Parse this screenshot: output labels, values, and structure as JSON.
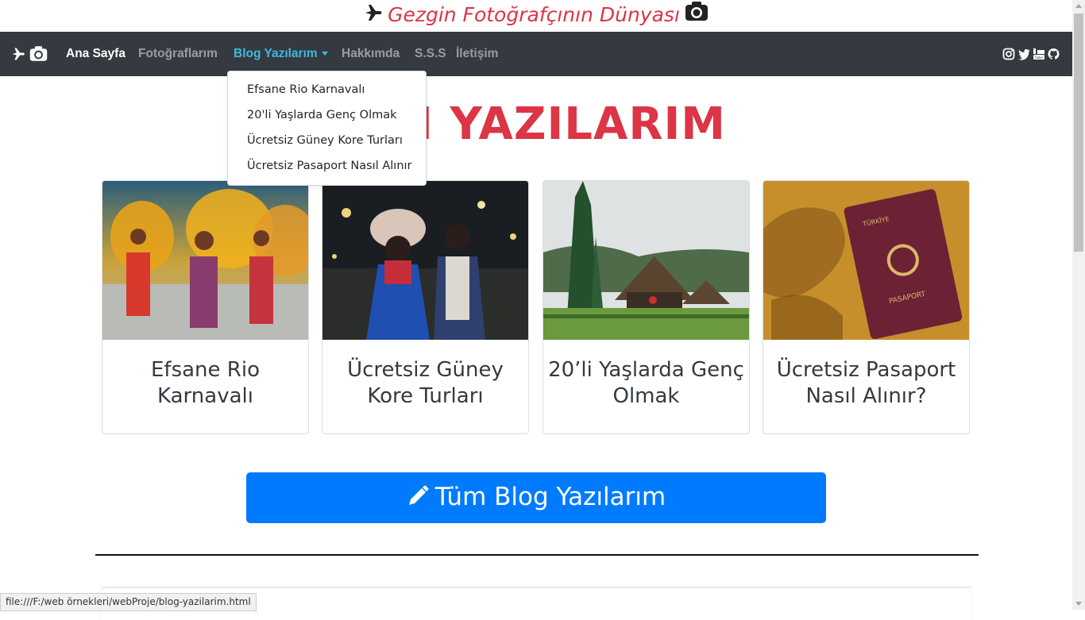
{
  "site": {
    "title": "Gezgin Fotoğrafçının Dünyası",
    "icons": [
      "plane-icon",
      "camera-icon"
    ]
  },
  "navbar": {
    "brand_icons": [
      "plane-icon",
      "camera-icon"
    ],
    "items": [
      {
        "label": "Ana Sayfa",
        "state": "active"
      },
      {
        "label": "Fotoğraflarım",
        "state": "normal"
      },
      {
        "label": "Blog Yazılarım",
        "state": "open-dropdown"
      },
      {
        "label": "Hakkımda",
        "state": "normal"
      },
      {
        "label": "S.S.S",
        "state": "normal"
      },
      {
        "label": "İletişim",
        "state": "normal"
      }
    ],
    "social_icons": [
      "instagram-icon",
      "twitter-icon",
      "youtube-icon",
      "github-icon"
    ]
  },
  "dropdown": {
    "items": [
      "Efsane Rio Karnavalı",
      "20'li Yaşlarda Genç Olmak",
      "Ücretsiz Güney Kore Turları",
      "Ücretsiz Pasaport Nasıl Alınır"
    ]
  },
  "main": {
    "heading": "N YAZILARIM",
    "cards": [
      {
        "title": "Efsane Rio Karnavalı"
      },
      {
        "title": "Ücretsiz Güney Kore Turları"
      },
      {
        "title": "20’li Yaşlarda Genç Olmak"
      },
      {
        "title": "Ücretsiz Pasaport Nasıl Alınır?"
      }
    ],
    "all_posts_button": "Tüm Blog Yazılarım"
  },
  "status_bar": {
    "url": "file:///F:/web örnekleri/webProje/blog-yazilarim.html"
  },
  "colors": {
    "accent_red": "#dc3545",
    "navbar_bg": "#343a40",
    "primary_blue": "#007bff",
    "nav_open": "#3fb8e0"
  }
}
